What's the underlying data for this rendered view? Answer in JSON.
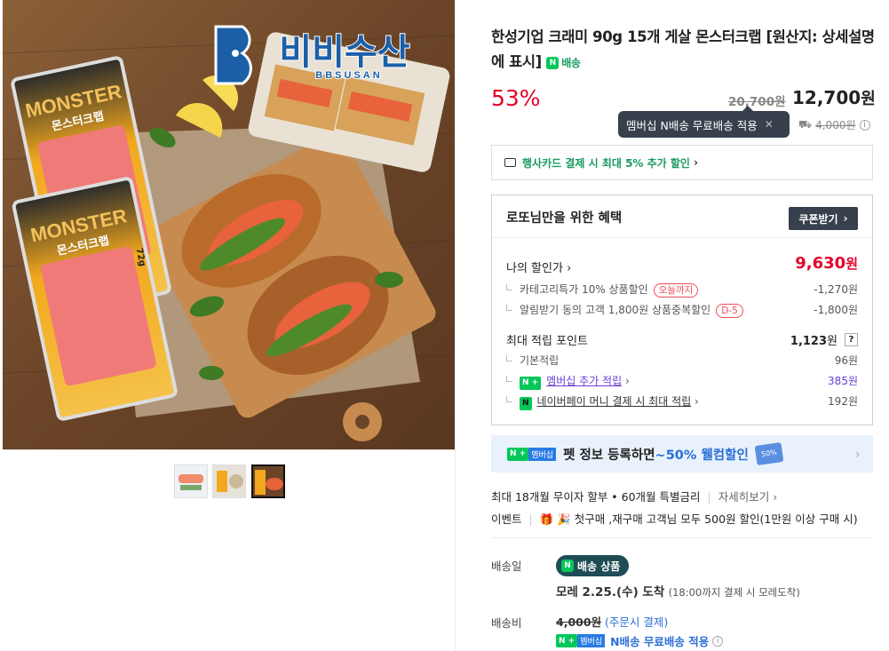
{
  "brand": {
    "logo_text": "비비수산",
    "logo_sub": "BBSUSAN"
  },
  "package": {
    "name_top": "MONSTER",
    "name_ko": "몬스터크랩",
    "weight": "72g"
  },
  "product": {
    "title": "한성기업 크래미 90g 15개 게살 몬스터크랩 [원산지: 상세설명에 표시]",
    "delivery_badge": "배송"
  },
  "price": {
    "discount_rate": "53%",
    "original": "20,700원",
    "sale_amount": "12,700",
    "sale_unit": "원",
    "tooltip": "멤버십 N배송 무료배송 적용",
    "ship_orig": "4,000원"
  },
  "card_promo": "행사카드 결제 시 최대 5% 추가 할인",
  "benefit": {
    "heading": "로또님만을 위한 혜택",
    "coupon_btn": "쿠폰받기",
    "my_price_label": "나의 할인가",
    "my_price_amount": "9,630",
    "my_price_unit": "원",
    "rows": [
      {
        "label": "카테고리특가 10% 상품할인",
        "tag": "오늘까지",
        "value": "-1,270원"
      },
      {
        "label": "알림받기 동의 고객 1,800원 상품중복할인",
        "tag": "D-5",
        "value": "-1,800원"
      }
    ],
    "points_label": "최대 적립 포인트",
    "points_amount": "1,123",
    "points_unit": "원",
    "help": "?",
    "point_rows": [
      {
        "label": "기본적립",
        "value": "96원"
      },
      {
        "label": "멤버십 추가 적립",
        "value": "385원"
      },
      {
        "label": "네이버페이 머니 결제 시 최대 적립",
        "value": "192원"
      }
    ]
  },
  "membership_banner": {
    "tag": "멤버십",
    "text1": "펫 정보 등록하면 ",
    "text2": "~50% 웰컴할인",
    "card": "50%"
  },
  "installment": {
    "text": "최대 18개월 무이자 할부 • 60개월 특별금리",
    "link": "자세히보기"
  },
  "event": {
    "label": "이벤트",
    "text": "🎉 첫구매 ,재구매 고객님 모두 500원 할인(1만원 이상 구매 시)"
  },
  "shipping": {
    "date_label": "배송일",
    "badge": "배송 상품",
    "arrival": "모레 2.25.(수) 도착",
    "arrival_note": "(18:00까지 결제 시 모레도착)",
    "fee_label": "배송비",
    "fee_orig": "4,000원",
    "fee_note": "(주문시 결제)",
    "free_text": "N배송 무료배송 적용"
  },
  "colors": {
    "discount": "#e4002b",
    "green": "#03c75a",
    "dark": "#37404c"
  }
}
